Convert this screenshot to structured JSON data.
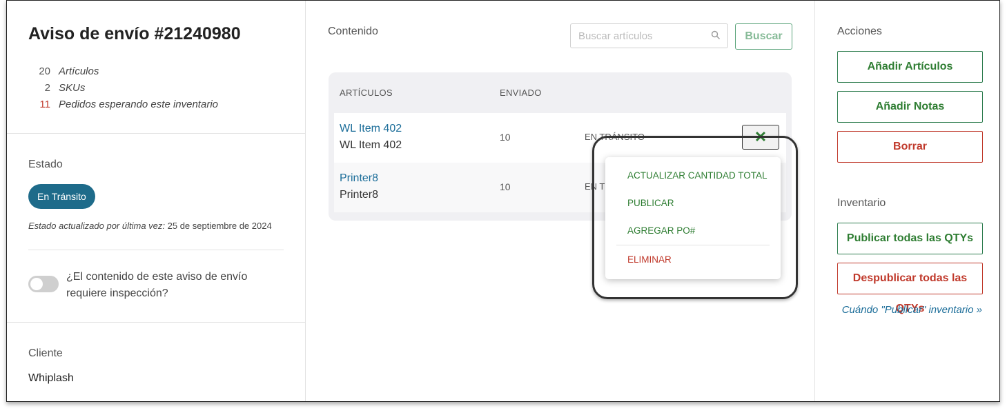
{
  "header": {
    "title": "Aviso de envío #21240980",
    "stats": [
      {
        "count": "20",
        "label": "Artículos",
        "color": "#555555"
      },
      {
        "count": "2",
        "label": "SKUs",
        "color": "#555555"
      },
      {
        "count": "11",
        "label": "Pedidos esperando este inventario",
        "color": "#c0392b"
      }
    ]
  },
  "estado": {
    "label": "Estado",
    "badge": "En Tránsito",
    "updated_prefix": "Estado actualizado por última vez:",
    "updated_date": "25 de septiembre de 2024",
    "inspection_question": "¿El contenido de este aviso de envío requiere inspección?",
    "inspection_enabled": false
  },
  "cliente": {
    "label": "Cliente",
    "name": "Whiplash"
  },
  "contenido": {
    "label": "Contenido",
    "search_placeholder": "Buscar artículos",
    "search_value": "",
    "search_button": "Buscar",
    "columns": [
      "ARTÍCULOS",
      "ENVIADO"
    ],
    "rows": [
      {
        "name": "WL Item 402",
        "sku": "WL Item 402",
        "qty": "10",
        "status": "EN TRÁNSITO",
        "close_icon": "x-icon"
      },
      {
        "name": "Printer8",
        "sku": "Printer8",
        "qty": "10",
        "status": "EN TRÁNSITO"
      }
    ]
  },
  "dropdown_menu": {
    "items": [
      {
        "label": "ACTUALIZAR CANTIDAD TOTAL",
        "color": "#2e7d32"
      },
      {
        "label": "PUBLICAR",
        "color": "#2e7d32"
      },
      {
        "label": "AGREGAR PO#",
        "color": "#2e7d32"
      },
      {
        "label": "ELIMINAR",
        "color": "#c0392b"
      }
    ]
  },
  "acciones": {
    "label": "Acciones",
    "add_items": "Añadir Artículos",
    "add_notes": "Añadir Notas",
    "delete": "Borrar"
  },
  "inventario": {
    "label": "Inventario",
    "publish_all": "Publicar todas las QTYs",
    "unpublish_all": "Despublicar todas las QTYs",
    "help_link": "Cuándo \"Publicar\" inventario »"
  },
  "colors": {
    "accent_green": "#2e7d32",
    "danger_red": "#c0392b",
    "badge_blue": "#1e6b8a",
    "link_blue": "#1b6d99"
  }
}
